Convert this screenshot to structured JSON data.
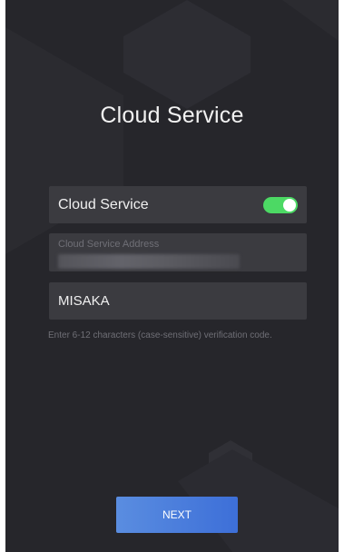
{
  "page": {
    "title": "Cloud Service"
  },
  "cloud_service_toggle": {
    "label": "Cloud Service",
    "enabled": true,
    "on_color": "#4cd964"
  },
  "address_field": {
    "placeholder": "Cloud Service Address",
    "value_redacted": true
  },
  "verification_field": {
    "value": "MISAKA"
  },
  "hint": "Enter 6-12 characters (case-sensitive) verification code.",
  "next_button": {
    "label": "NEXT",
    "color": "#4a7ddc"
  },
  "colors": {
    "background": "#26262b",
    "field_background": "#3b3b40"
  }
}
